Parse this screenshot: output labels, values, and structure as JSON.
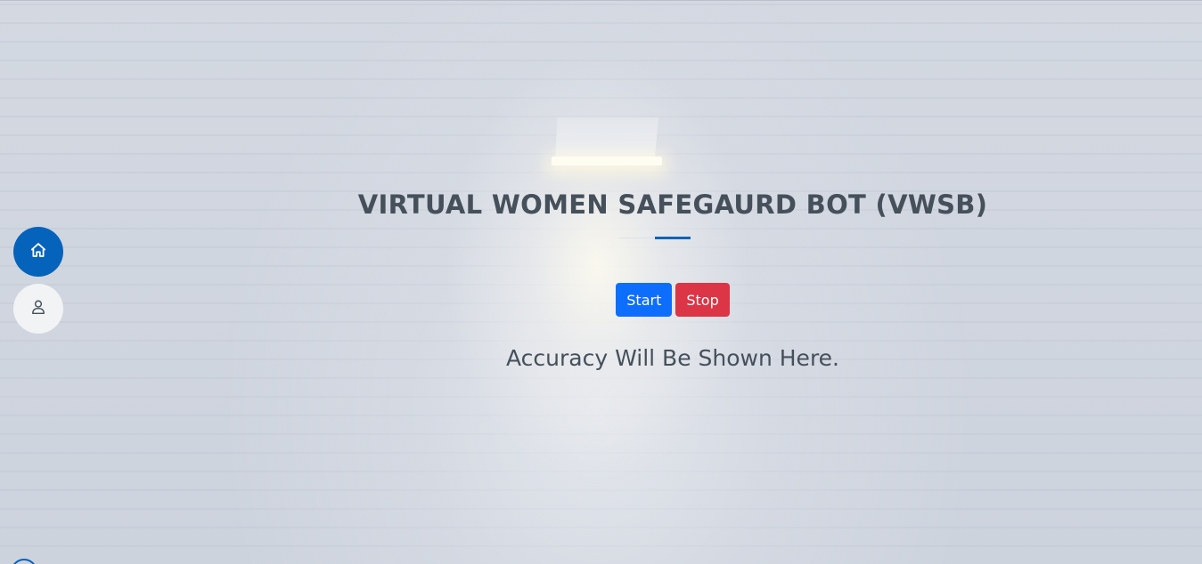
{
  "page": {
    "title": "VIRTUAL WOMEN SAFEGAURD BOT (VWSB)",
    "accuracy_text": "Accuracy Will Be Shown Here."
  },
  "controls": {
    "start_label": "Start",
    "stop_label": "Stop"
  },
  "nav": {
    "items": [
      {
        "icon": "home-icon",
        "active": true
      },
      {
        "icon": "user-icon",
        "active": false
      }
    ]
  },
  "colors": {
    "accent": "#0563bb",
    "start": "#0d6efd",
    "stop": "#dc3545",
    "text": "#45505b"
  }
}
